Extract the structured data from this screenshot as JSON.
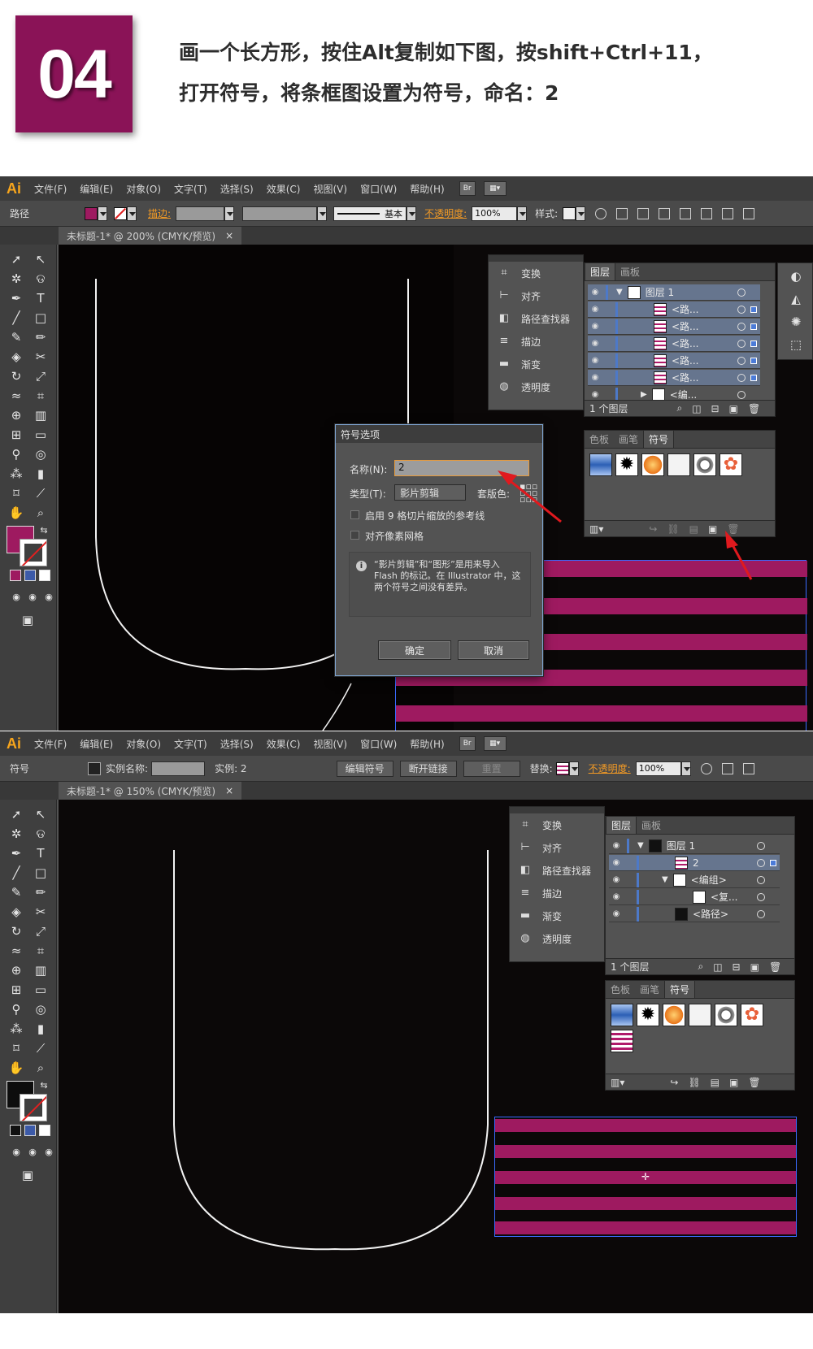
{
  "header": {
    "step": "04",
    "line1": "画一个长方形，按住Alt复制如下图，按shift+Ctrl+11，",
    "line2": "打开符号，将条框图设置为符号，命名：2"
  },
  "app": {
    "logo": "Ai",
    "menus": [
      "文件(F)",
      "编辑(E)",
      "对象(O)",
      "文字(T)",
      "选择(S)",
      "效果(C)",
      "视图(V)",
      "窗口(W)",
      "帮助(H)"
    ],
    "br_label": "Br"
  },
  "shot1": {
    "ctrl": {
      "selection_label": "路径",
      "stroke_label": "描边:",
      "stroke_style": "基本",
      "opacity_label": "不透明度:",
      "opacity_value": "100%",
      "style_label": "样式:"
    },
    "doc_tab": "未标题-1* @ 200% (CMYK/预览)",
    "close": "×",
    "props_panel": [
      "变换",
      "对齐",
      "路径查找器",
      "描边",
      "渐变",
      "透明度"
    ],
    "layers_tabs": [
      "图层",
      "画板"
    ],
    "layers": {
      "layer_name": "图层 1",
      "rows": [
        "<路...",
        "<路...",
        "<路...",
        "<路...",
        "<路...",
        "<编..."
      ],
      "count": "1 个图层"
    },
    "symbols_tabs": [
      "色板",
      "画笔",
      "符号"
    ],
    "dialog": {
      "title": "符号选项",
      "name_label": "名称(N):",
      "name_value": "2",
      "type_label": "类型(T):",
      "type_value": "影片剪辑",
      "registration_label": "套版色:",
      "nine_slice_label": "启用 9 格切片缩放的参考线",
      "pixel_grid_label": "对齐像素网格",
      "info": "“影片剪辑”和“图形”是用来导入 Flash 的标记。在 Illustrator 中，这两个符号之间没有差异。",
      "ok": "确定",
      "cancel": "取消"
    }
  },
  "shot2": {
    "ctrl": {
      "selection_label": "符号",
      "instance_name_label": "实例名称:",
      "instance_label": "实例: 2",
      "edit_symbol": "编辑符号",
      "break_link": "断开链接",
      "reset": "重置",
      "replace_label": "替换:",
      "opacity_label": "不透明度:",
      "opacity_value": "100%"
    },
    "doc_tab": "未标题-1* @ 150% (CMYK/预览)",
    "close": "×",
    "props_panel": [
      "变换",
      "对齐",
      "路径查找器",
      "描边",
      "渐变",
      "透明度"
    ],
    "layers_tabs": [
      "图层",
      "画板"
    ],
    "layers": {
      "layer_name": "图层 1",
      "rows": [
        "2",
        "<编组>",
        "<复...",
        "<路径>"
      ],
      "count": "1 个图层"
    },
    "symbols_tabs": [
      "色板",
      "画笔",
      "符号"
    ]
  },
  "colors": {
    "badge": "#8a1357",
    "stripe": "#9e1a60",
    "canvas": "#0b0808",
    "accent_orange": "#f29a25"
  }
}
